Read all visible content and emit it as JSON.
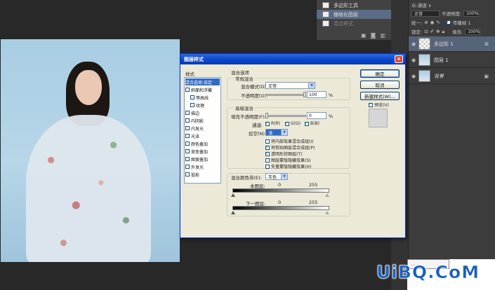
{
  "paths_panel": {
    "items": [
      {
        "label": "多边形工具",
        "selected": false
      },
      {
        "label": "栅格化图层",
        "selected": true
      },
      {
        "label": "混合样式",
        "selected": false,
        "faded": true
      },
      {
        "label": "",
        "selected": false,
        "faded": true
      }
    ]
  },
  "layers_panel": {
    "top_label": "示:通道 ∨",
    "blend_mode": "正常",
    "opacity_label": "不透明度:",
    "opacity_value": "100%",
    "lock_label": "锁定:",
    "fill_label": "填充:",
    "fill_value": "100%",
    "propagate_label": "传播帧 1",
    "unify_label": "统一:",
    "layers": [
      {
        "name": "多边形 1",
        "selected": true,
        "thumb": "check"
      },
      {
        "name": "图层 1",
        "selected": false,
        "thumb": "photo"
      },
      {
        "name": "背景",
        "selected": false,
        "thumb": "photo",
        "italic": true
      }
    ]
  },
  "dialog": {
    "title": "图层样式",
    "close_glyph": "✕",
    "styles_header": "样式",
    "styles": [
      {
        "label": "混合选项:自定",
        "checkbox": false,
        "selected": true,
        "indent": false
      },
      {
        "label": "斜面和浮雕",
        "checkbox": true,
        "checked": false,
        "indent": false
      },
      {
        "label": "等高线",
        "checkbox": true,
        "checked": false,
        "indent": true
      },
      {
        "label": "纹理",
        "checkbox": true,
        "checked": false,
        "indent": true
      },
      {
        "label": "描边",
        "checkbox": true,
        "checked": false,
        "indent": false
      },
      {
        "label": "内阴影",
        "checkbox": true,
        "checked": false,
        "indent": false
      },
      {
        "label": "内发光",
        "checkbox": true,
        "checked": false,
        "indent": false
      },
      {
        "label": "光泽",
        "checkbox": true,
        "checked": false,
        "indent": false
      },
      {
        "label": "颜色叠加",
        "checkbox": true,
        "checked": false,
        "indent": false
      },
      {
        "label": "渐变叠加",
        "checkbox": true,
        "checked": false,
        "indent": false
      },
      {
        "label": "图案叠加",
        "checkbox": true,
        "checked": false,
        "indent": false
      },
      {
        "label": "外发光",
        "checkbox": true,
        "checked": false,
        "indent": false
      },
      {
        "label": "投影",
        "checkbox": true,
        "checked": false,
        "indent": false
      }
    ],
    "blend_options_title": "混合选项",
    "general_blending_title": "常规混合",
    "blend_mode_label": "混合模式(D):",
    "blend_mode_value": "正常",
    "opacity_label": "不透明度(O):",
    "opacity_value": "100",
    "opacity_unit": "%",
    "advanced_blending_title": "高级混合",
    "fill_opacity_label": "填充不透明度(F):",
    "fill_opacity_value": "0",
    "fill_opacity_unit": "%",
    "channels_label": "通道:",
    "channel_r": "R(R)",
    "channel_g": "G(G)",
    "channel_b": "B(B)",
    "knockout_label": "挖空(N):",
    "knockout_value": "浅",
    "adv_options": [
      {
        "label": "将内部效果混合成组(I)",
        "checked": false
      },
      {
        "label": "将剪贴图层混合成组(P)",
        "checked": true
      },
      {
        "label": "透明形状图层(T)",
        "checked": true
      },
      {
        "label": "图层蒙版隐藏效果(S)",
        "checked": false
      },
      {
        "label": "矢量蒙版隐藏效果(H)",
        "checked": false
      }
    ],
    "blend_if_label": "混合颜色带(E):",
    "blend_if_value": "灰色",
    "this_layer_label": "本图层:",
    "this_layer_min": "0",
    "this_layer_max": "255",
    "under_layer_label": "下一图层:",
    "under_layer_min": "0",
    "under_layer_max": "255",
    "ok_label": "确定",
    "cancel_label": "取消",
    "new_style_label": "新建样式(W)...",
    "preview_label": "预览(V)",
    "preview_checked": true
  },
  "watermark": {
    "text": "UiBQ.CoM",
    "popup_text": "…"
  },
  "colors": {
    "titlebar": "#0a47c9",
    "selection": "#316ac5",
    "dialog_bg": "#ece9d8",
    "workspace": "#282828"
  }
}
